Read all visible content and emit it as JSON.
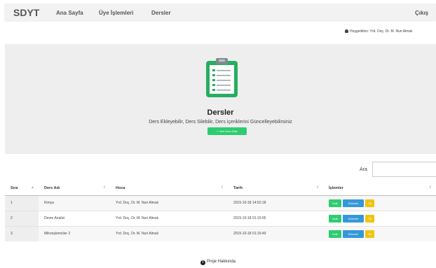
{
  "navbar": {
    "brand": "SDYT",
    "home": "Ana Sayfa",
    "members": "Üye İşlemleri",
    "courses": "Dersler",
    "logout": "Çıkış"
  },
  "welcome": "Hoşgeldiniz: Yrd. Doç. Dr. M. Nuri Almalı",
  "jumbotron": {
    "icon": "clipboard-icon",
    "title": "Dersler",
    "subtitle": "Ders Ekleyebilir, Ders Silebilir, Ders içeriklerini Güncelleyebilirsiniz",
    "new_button": "+ Yeni Ders Ekle"
  },
  "search": {
    "label": "Ara",
    "value": ""
  },
  "table": {
    "headers": [
      "Sıra",
      "Ders Adı",
      "Hoca",
      "Tarih",
      "İşlemler"
    ],
    "rows": [
      {
        "sira": "1",
        "ders": "Kimya",
        "hoca": "Yrd. Doç. Dr. M. Nuri Almalı",
        "tarih": "2015-10-18 14:52:18"
      },
      {
        "sira": "2",
        "ders": "Devre Analizi",
        "hoca": "Yrd. Doç. Dr. M. Nuri Almalı",
        "tarih": "2015-10-18 01:15:55"
      },
      {
        "sira": "3",
        "ders": "Mikroişlemciler 2",
        "hoca": "Yrd. Doç. Dr. M. Nuri Almalı",
        "tarih": "2015-10-18 01:16:49"
      }
    ],
    "actions": {
      "download": "İndir",
      "edit": "Düzenle",
      "delete": "Sil"
    }
  },
  "footer": {
    "label": "Proje Hakkında",
    "icon": "info-icon"
  },
  "colors": {
    "green": "#2ecc71",
    "blue": "#3498db",
    "yellow": "#f1c40f",
    "navbar": "#f2f2f2",
    "jumbotron": "#eeeeee"
  }
}
